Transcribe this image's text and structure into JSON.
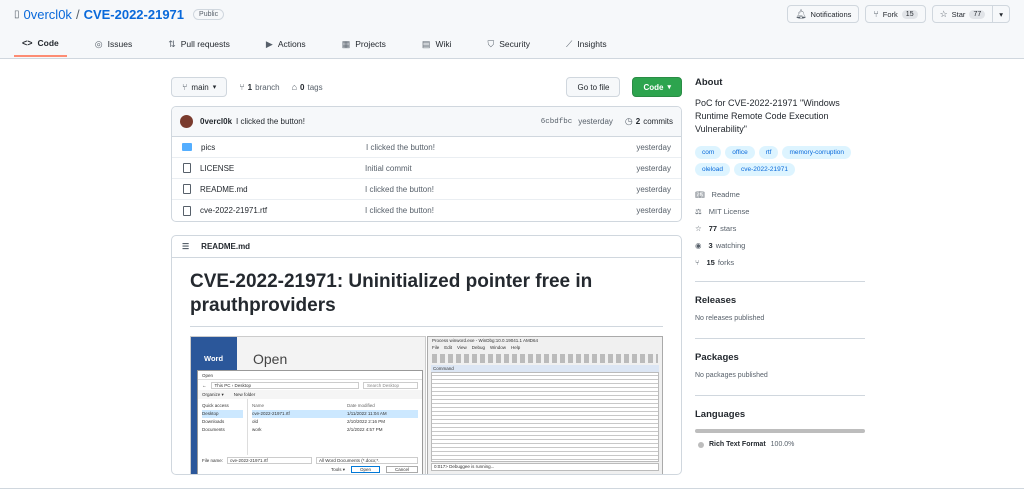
{
  "repo": {
    "owner": "0vercl0k",
    "sep": "/",
    "name": "CVE-2022-21971",
    "visibility": "Public"
  },
  "header_buttons": {
    "notifications": "Notifications",
    "fork": "Fork",
    "fork_count": "15",
    "star": "Star",
    "star_count": "77"
  },
  "tabs": [
    {
      "label": "Code",
      "icon": "code-icon"
    },
    {
      "label": "Issues",
      "icon": "issues-icon"
    },
    {
      "label": "Pull requests",
      "icon": "pull-request-icon"
    },
    {
      "label": "Actions",
      "icon": "actions-icon"
    },
    {
      "label": "Projects",
      "icon": "projects-icon"
    },
    {
      "label": "Wiki",
      "icon": "wiki-icon"
    },
    {
      "label": "Security",
      "icon": "shield-icon"
    },
    {
      "label": "Insights",
      "icon": "graph-icon"
    }
  ],
  "toolbar": {
    "branch": "main",
    "branches_count": "1",
    "branches_label": "branch",
    "tags_count": "0",
    "tags_label": "tags",
    "goto_file": "Go to file",
    "code": "Code"
  },
  "latest_commit": {
    "author": "0vercl0k",
    "message": "I clicked the button!",
    "hash": "6cbdfbc",
    "date": "yesterday",
    "commits_count": "2",
    "commits_label": "commits"
  },
  "files": [
    {
      "type": "folder",
      "name": "pics",
      "message": "I clicked the button!",
      "date": "yesterday"
    },
    {
      "type": "file",
      "name": "LICENSE",
      "message": "Initial commit",
      "date": "yesterday"
    },
    {
      "type": "file",
      "name": "README.md",
      "message": "I clicked the button!",
      "date": "yesterday"
    },
    {
      "type": "file",
      "name": "cve-2022-21971.rtf",
      "message": "I clicked the button!",
      "date": "yesterday"
    }
  ],
  "readme": {
    "filename": "README.md",
    "heading": "CVE-2022-21971: Uninitialized pointer free in prauthproviders",
    "screenshot": {
      "word_label": "Word",
      "open_label": "Open",
      "dialog_title": "Open",
      "path": "This PC › Desktop",
      "search_placeholder": "Search Desktop",
      "organize": "Organize ▾",
      "new_folder": "New folder",
      "nav_items": [
        "Quick access",
        "Desktop",
        "Downloads",
        "Documents"
      ],
      "col_name": "Name",
      "col_date": "Date modified",
      "files": [
        {
          "name": "cve-2022-21971.rtf",
          "date": "1/11/2022 11:04 AM"
        },
        {
          "name": "old",
          "date": "2/10/2022 2:16 PM"
        },
        {
          "name": "work",
          "date": "2/1/2022 4:57 PM"
        }
      ],
      "filename_label": "File name:",
      "filename_value": "cve-2022-21971.rtf",
      "filter": "All Word Documents (*.docx;*.",
      "tools": "Tools ▾",
      "open_btn": "Open",
      "cancel_btn": "Cancel",
      "windbg_title": "Process winword.exe - WinDbg:10.0.19041.1 AMD64",
      "windbg_menu": [
        "File",
        "Edit",
        "View",
        "Debug",
        "Window",
        "Help"
      ],
      "command_label": "Command",
      "prompt": "0:017> Debuggee is running..."
    }
  },
  "about": {
    "title": "About",
    "description": "PoC for CVE-2022-21971 \"Windows Runtime Remote Code Execution Vulnerability\"",
    "topics": [
      "com",
      "office",
      "rtf",
      "memory-corruption",
      "oleload",
      "cve-2022-21971"
    ],
    "readme": "Readme",
    "license": "MIT License",
    "stars_count": "77",
    "stars_label": "stars",
    "watching_count": "3",
    "watching_label": "watching",
    "forks_count": "15",
    "forks_label": "forks"
  },
  "releases": {
    "title": "Releases",
    "text": "No releases published"
  },
  "packages": {
    "title": "Packages",
    "text": "No packages published"
  },
  "languages": {
    "title": "Languages",
    "name": "Rich Text Format",
    "percent": "100.0%",
    "color": "#bdbdbd"
  }
}
